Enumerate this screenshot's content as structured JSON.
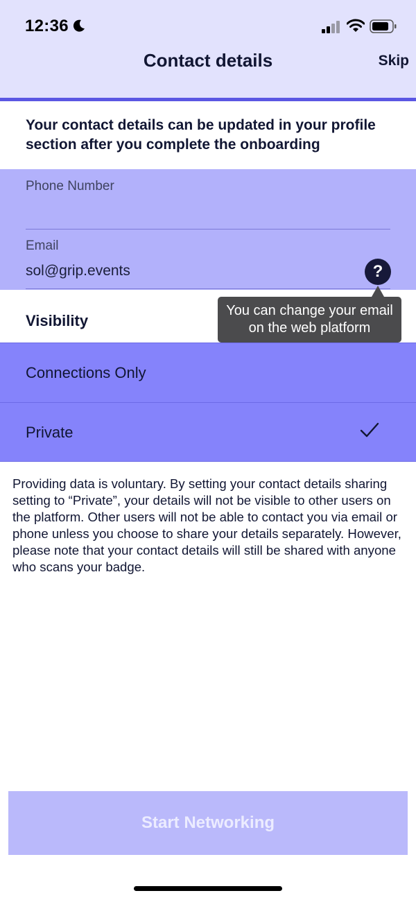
{
  "status_bar": {
    "time": "12:36",
    "icons": [
      "moon-icon",
      "signal-icon",
      "wifi-icon",
      "battery-icon"
    ]
  },
  "nav": {
    "title": "Contact details",
    "skip_label": "Skip"
  },
  "intro": "Your contact details can be updated in your profile section after you complete the onboarding",
  "form": {
    "phone": {
      "label": "Phone Number",
      "value": ""
    },
    "email": {
      "label": "Email",
      "value": "sol@grip.events",
      "help_icon": "?"
    }
  },
  "tooltip": "You can change your email on the web platform",
  "visibility": {
    "heading": "Visibility",
    "options": [
      {
        "label": "Connections Only",
        "selected": false
      },
      {
        "label": "Private",
        "selected": true
      }
    ]
  },
  "disclaimer": "Providing data is voluntary. By setting your contact details sharing setting to “Private”, your details will not be visible to other users on the platform. Other users will not be able to contact you via email or phone unless you choose to share your details separately. However, please note that your contact details will still be shared with anyone who scans your badge.",
  "start_button": {
    "label": "Start Networking",
    "enabled": false
  },
  "colors": {
    "header_bg": "#e2e2fd",
    "accent": "#5b57e3",
    "form_bg": "#b2b1fb",
    "option_bg": "#8583fb",
    "tooltip_bg": "#4b4b4d",
    "button_disabled": "#bab9fb"
  }
}
